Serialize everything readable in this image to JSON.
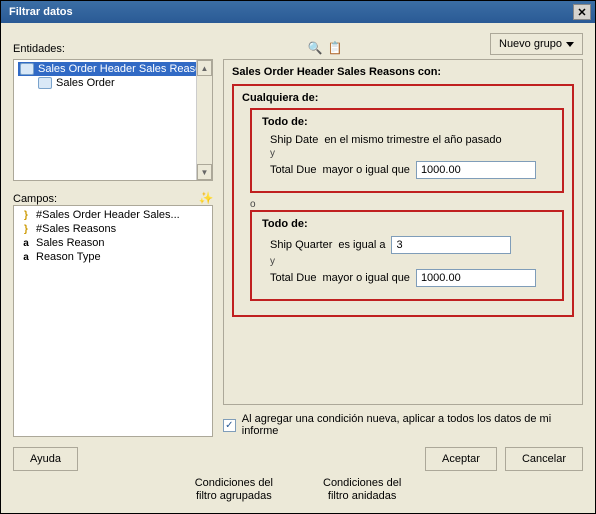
{
  "title": "Filtrar datos",
  "entities_label": "Entidades:",
  "nuevo_grupo": "Nuevo grupo",
  "tree": {
    "root": "Sales Order Header Sales Reasor",
    "child": "Sales Order"
  },
  "fields_label": "Campos:",
  "fields": [
    {
      "icon": "}",
      "label": "#Sales Order Header Sales..."
    },
    {
      "icon": "}",
      "label": "#Sales Reasons"
    },
    {
      "icon": "a",
      "label": "Sales Reason"
    },
    {
      "icon": "a",
      "label": "Reason Type"
    }
  ],
  "cond_header": "Sales Order Header Sales Reasons con:",
  "cualquiera": "Cualquiera de:",
  "todo": "Todo de:",
  "c1": {
    "field": "Ship Date",
    "op": "en el mismo trimestre el año pasado"
  },
  "c2": {
    "field": "Total Due",
    "op": "mayor o igual que",
    "val": "1000.00"
  },
  "c3": {
    "field": "Ship Quarter",
    "op": "es igual a",
    "val": "3"
  },
  "c4": {
    "field": "Total Due",
    "op": "mayor o igual que",
    "val": "1000.00"
  },
  "y": "y",
  "o": "o",
  "checkbox_label": "Al agregar una condición nueva, aplicar a todos los datos de mi informe",
  "ayuda": "Ayuda",
  "aceptar": "Aceptar",
  "cancelar": "Cancelar",
  "annot1_l1": "Condiciones del",
  "annot1_l2": "filtro agrupadas",
  "annot2_l1": "Condiciones del",
  "annot2_l2": "filtro anidadas"
}
